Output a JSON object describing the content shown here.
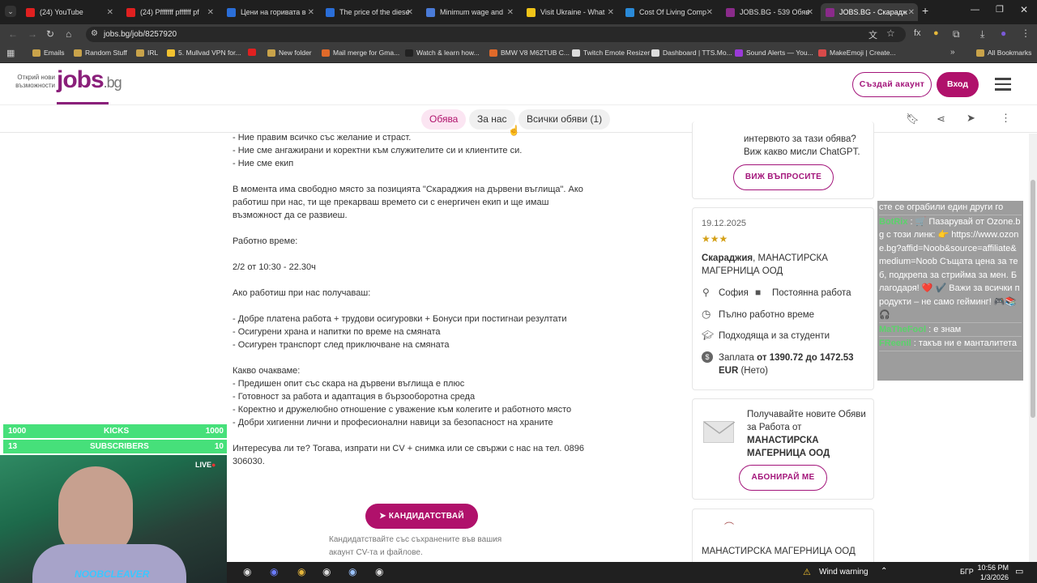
{
  "browser": {
    "tabs": [
      {
        "title": "(24) YouTube",
        "color": "#e02020"
      },
      {
        "title": "(24) Pfffffff pffffff pf",
        "color": "#e02020"
      },
      {
        "title": "Цени на горивата в",
        "color": "#2a6ed8"
      },
      {
        "title": "The price of the diese",
        "color": "#2a6ed8"
      },
      {
        "title": "Minimum wage and",
        "color": "#4a7bd8"
      },
      {
        "title": "Visit Ukraine - What",
        "color": "#f0c419"
      },
      {
        "title": "Cost Of Living Comp",
        "color": "#2a8ad8"
      },
      {
        "title": "JOBS.BG - 539 Обяв",
        "color": "#8a2b8a"
      },
      {
        "title": "JOBS.BG - Скарадж",
        "color": "#8a2b8a"
      }
    ],
    "url": "jobs.bg/job/8257920",
    "bookmarks": [
      "Emails",
      "Random Stuff",
      "IRL",
      "5. Mullvad VPN for...",
      "",
      "New folder",
      "Mail merge for Gma...",
      "Watch & learn how...",
      "BMW V8 M62TUB C...",
      "Twitch Emote Resizer",
      "Dashboard | TTS.Mo...",
      "Sound Alerts — You...",
      "MakeEmoji | Create..."
    ],
    "all_bookmarks": "All Bookmarks"
  },
  "site": {
    "logo_tag1": "Открий нови",
    "logo_tag2": "възможности",
    "logo_main": "jobs",
    "logo_suffix": ".bg",
    "create_account": "Създай акаунт",
    "login": "Вход",
    "tabs": [
      "Обява",
      "За нас",
      "Всички обяви (1)"
    ]
  },
  "job": {
    "lines": [
      "- Ние правим всичко със желание и страст.",
      "- Ние сме ангажирани и коректни към служителите си и клиентите си.",
      "- Ние сме екип",
      "",
      "В момента има свободно място за позицията \"Скараджия на дървени въглища\". Ако",
      "работиш при нас, ти ще прекарваш времето си с енергичен екип и ще имаш",
      "възможност да се развиеш.",
      "",
      "Работно време:",
      "",
      "2/2 от 10:30 - 22.30ч",
      "",
      "Ако работиш при нас получаваш:",
      "",
      "- Добре платена работа + трудови осигуровки + Бонуси при постигнаи резултати",
      "- Осигурени храна и напитки по време на смяната",
      "- Осигурен транспорт след приключване на смяната",
      "",
      "Какво очакваме:",
      "- Предишен опит със скара на дървени въглища е плюс",
      "- Готовност за работа и адаптация в бързооборотна среда",
      "- Коректно и дружелюбно отношение с уважение към колегите и работното място",
      "- Добри хигиенни лични и професионални навици за безопасност на храните",
      "",
      "Интересува ли те? Тогава, изпрати ни CV + снимка или се свържи с нас на тел. 0896",
      "306030."
    ],
    "apply": "КАНДИДАТСТВАЙ",
    "apply_note1": "Кандидатствайте със съхранените във вашия",
    "apply_note2": "акаунт CV-та и файлове."
  },
  "side": {
    "chatgpt_1": "интервюто за тази обява?",
    "chatgpt_2": "Виж какво мисли ChatGPT.",
    "questions_btn": "ВИЖ ВЪПРОСИТЕ",
    "date": "19.12.2025",
    "stars": "★★★",
    "title_bold": "Скараджия",
    "title_rest": ", МАНАСТИРСКА",
    "title_line2": "МАГЕРНИЦА ООД",
    "city": "София",
    "type": "Постоянна работа",
    "hours": "Пълно работно време",
    "students": "Подходяща и за студенти",
    "salary_label": "Заплата ",
    "salary_value": "от 1390.72 до 1472.53",
    "salary_unit": "EUR",
    "salary_net": " (Нето)",
    "subscribe_1": "Получавайте новите Обяви",
    "subscribe_2": "за Работа от",
    "subscribe_3": "МАНАСТИРСКА",
    "subscribe_4": "МАГЕРНИЦА ООД",
    "subscribe_btn": "АБОНИРАЙ МЕ",
    "company": "МАНАСТИРСКА МАГЕРНИЦА ООД"
  },
  "stream": {
    "kicks_label": "KICKS",
    "kicks_left": "1000",
    "kicks_right": "1000",
    "subs_label": "SUBSCRIBERS",
    "subs_left": "13",
    "subs_right": "10",
    "live": "LIVE",
    "name": "NOOBCLEAVER",
    "chat": [
      {
        "user": "",
        "text": "сте се ограбили един други го"
      },
      {
        "user": "BotRix",
        "text": " : 🛒 Пазарувай от Ozone.bg с този линк: 👉 https://www.ozone.bg?affid=Noob&source=affiliate&medium=Noob Същата цена за теб, подкрепа за стрийма за мен. Благодаря! ❤️ ✔️ Важи за всички продукти – не само гейминг! 🎮📚🎧"
      },
      {
        "user": "MaTheFool",
        "text": " : е знам"
      },
      {
        "user": "FReenil",
        "text": " : такъв ни е манталитета"
      }
    ]
  },
  "taskbar": {
    "weather": "Wind warning",
    "lang": "БГР",
    "time": "10:56 PM",
    "date": "1/3/2026"
  }
}
